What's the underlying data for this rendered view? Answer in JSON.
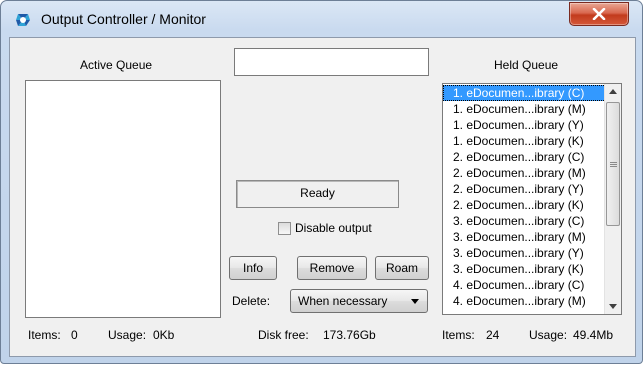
{
  "window": {
    "title": "Output Controller / Monitor"
  },
  "active_queue": {
    "header": "Active Queue",
    "items_label": "Items:",
    "items_value": "0",
    "usage_label": "Usage:",
    "usage_value": "0Kb"
  },
  "center": {
    "job_field_value": "",
    "status_text": "Ready",
    "disable_output_label": "Disable output",
    "disable_output_checked": false,
    "info_button": "Info",
    "remove_button": "Remove",
    "roam_button": "Roam",
    "delete_label": "Delete:",
    "delete_selected": "When necessary",
    "disk_free_label": "Disk free:",
    "disk_free_value": "173.76Gb"
  },
  "held_queue": {
    "header": "Held Queue",
    "items": [
      "1. eDocumen...ibrary (C)",
      "1. eDocumen...ibrary (M)",
      "1. eDocumen...ibrary (Y)",
      "1. eDocumen...ibrary (K)",
      "2. eDocumen...ibrary (C)",
      "2. eDocumen...ibrary (M)",
      "2. eDocumen...ibrary (Y)",
      "2. eDocumen...ibrary (K)",
      "3. eDocumen...ibrary (C)",
      "3. eDocumen...ibrary (M)",
      "3. eDocumen...ibrary (Y)",
      "3. eDocumen...ibrary (K)",
      "4. eDocumen...ibrary (C)",
      "4. eDocumen...ibrary (M)"
    ],
    "selected_index": 0,
    "items_label": "Items:",
    "items_value": "24",
    "usage_label": "Usage:",
    "usage_value": "49.4Mb"
  },
  "icons": {
    "title": "app-logo-icon",
    "close": "close-icon",
    "checkbox": "checkbox",
    "dropdown": "chevron-down-icon"
  }
}
